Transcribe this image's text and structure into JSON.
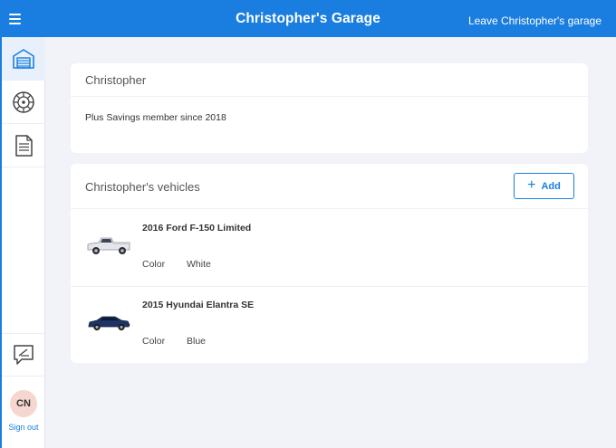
{
  "header": {
    "title": "Christopher's Garage",
    "leave_label": "Leave Christopher's garage"
  },
  "sidebar": {
    "items": [
      {
        "icon": "garage-icon",
        "active": true
      },
      {
        "icon": "tire-icon",
        "active": false
      },
      {
        "icon": "document-icon",
        "active": false
      },
      {
        "icon": "feedback-icon",
        "active": false
      }
    ],
    "avatar_initials": "CN",
    "signout_label": "Sign out"
  },
  "profile": {
    "name": "Christopher",
    "member_text": "Plus Savings member since 2018"
  },
  "vehicles_section": {
    "title": "Christopher's vehicles",
    "add_label": "Add",
    "items": [
      {
        "name": "2016 Ford F-150 Limited",
        "color_label": "Color",
        "color_value": "White",
        "car_color": "#e4e6ea"
      },
      {
        "name": "2015 Hyundai Elantra SE",
        "color_label": "Color",
        "color_value": "Blue",
        "car_color": "#1e3564"
      }
    ]
  },
  "colors": {
    "brand": "#1a7de0",
    "background": "#f2f3f8"
  }
}
